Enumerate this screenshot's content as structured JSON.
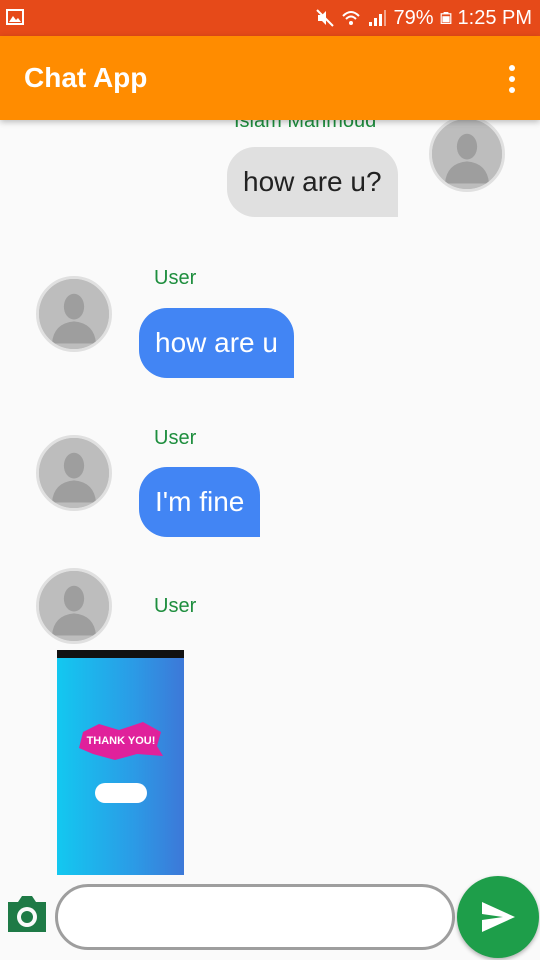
{
  "status_bar": {
    "battery": "79%",
    "time": "1:25 PM",
    "icons": [
      "gallery-icon",
      "mute-icon",
      "wifi-icon",
      "signal-icon",
      "battery-icon"
    ]
  },
  "app_bar": {
    "title": "Chat App",
    "menu_icon": "more-vert-icon"
  },
  "messages": [
    {
      "direction": "outgoing",
      "sender": "Islam Mahmoud",
      "text": "how are u?"
    },
    {
      "direction": "incoming",
      "sender": "User",
      "text": "how are u"
    },
    {
      "direction": "incoming",
      "sender": "User",
      "text": "I'm fine"
    },
    {
      "direction": "incoming",
      "sender": "User",
      "type": "image",
      "image_text": "THANK YOU!"
    }
  ],
  "composer": {
    "camera_icon": "camera-icon",
    "input_value": "",
    "input_placeholder": "",
    "send_icon": "send-icon"
  },
  "colors": {
    "status_bar": "#e64a19",
    "app_bar": "#ff8c00",
    "incoming_bubble": "#4285f4",
    "outgoing_bubble": "#e0e0e0",
    "sender_name": "#1e8e3e",
    "send_button": "#1e9e4a"
  }
}
